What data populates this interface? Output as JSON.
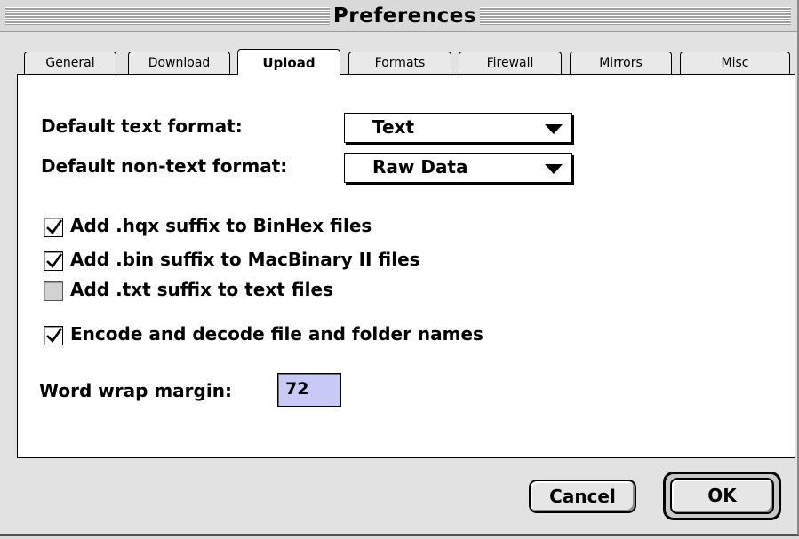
{
  "window": {
    "title": "Preferences"
  },
  "tabs": [
    {
      "label": "General",
      "active": false
    },
    {
      "label": "Download",
      "active": false
    },
    {
      "label": "Upload",
      "active": true
    },
    {
      "label": "Formats",
      "active": false
    },
    {
      "label": "Firewall",
      "active": false
    },
    {
      "label": "Mirrors",
      "active": false
    },
    {
      "label": "Misc",
      "active": false
    }
  ],
  "upload": {
    "text_format_label": "Default text format:",
    "text_format_value": "Text",
    "nontext_format_label": "Default non-text format:",
    "nontext_format_value": "Raw Data",
    "checkboxes": [
      {
        "label": "Add .hqx suffix to BinHex files",
        "checked": true
      },
      {
        "label": "Add .bin suffix to MacBinary II files",
        "checked": true
      },
      {
        "label": "Add .txt suffix to text files",
        "checked": false
      },
      {
        "label": "Encode and decode file and folder names",
        "checked": true
      }
    ],
    "word_wrap_label": "Word wrap margin:",
    "word_wrap_value": "72"
  },
  "buttons": {
    "cancel": "Cancel",
    "ok": "OK"
  }
}
